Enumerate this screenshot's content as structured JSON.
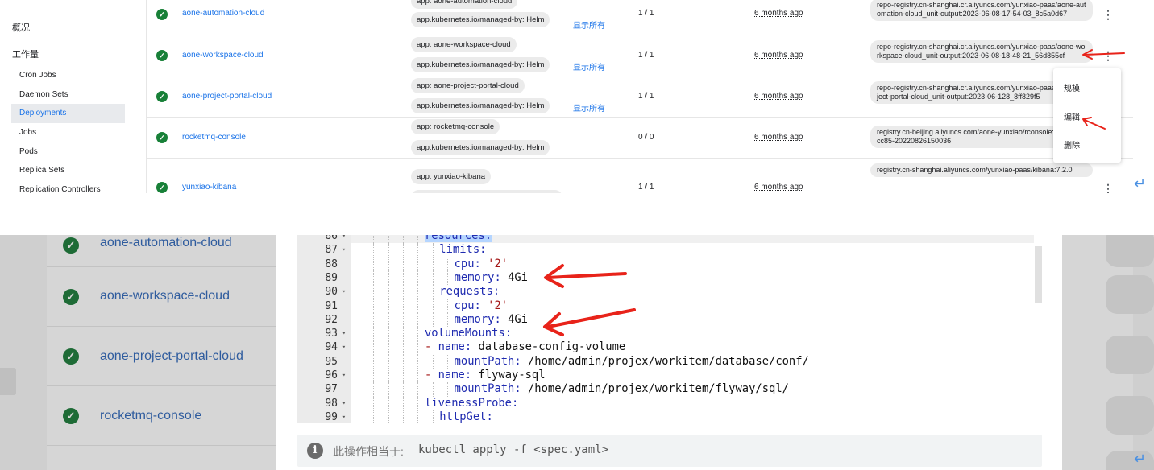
{
  "sidebar": {
    "overview": "概况",
    "workloads": "工作量",
    "items": [
      {
        "label": "Cron Jobs",
        "active": false
      },
      {
        "label": "Daemon Sets",
        "active": false
      },
      {
        "label": "Deployments",
        "active": true
      },
      {
        "label": "Jobs",
        "active": false
      },
      {
        "label": "Pods",
        "active": false
      },
      {
        "label": "Replica Sets",
        "active": false
      },
      {
        "label": "Replication Controllers",
        "active": false
      }
    ]
  },
  "deployments": [
    {
      "name": "aone-automation-cloud",
      "labels": [
        "app: aone-automation-cloud",
        "app.kubernetes.io/managed-by: Helm"
      ],
      "show_all": "显示所有",
      "pods": "1 / 1",
      "created": "6 months ago",
      "image": "repo-registry.cn-shanghai.cr.aliyuncs.com/yunxiao-paas/aone-automation-cloud_unit-output:2023-06-08-17-54-03_8c5a0d67"
    },
    {
      "name": "aone-workspace-cloud",
      "labels": [
        "app: aone-workspace-cloud",
        "app.kubernetes.io/managed-by: Helm"
      ],
      "show_all": "显示所有",
      "pods": "1 / 1",
      "created": "6 months ago",
      "image": "repo-registry.cn-shanghai.cr.aliyuncs.com/yunxiao-paas/aone-workspace-cloud_unit-output:2023-06-08-18-48-21_56d855cf"
    },
    {
      "name": "aone-project-portal-cloud",
      "labels": [
        "app: aone-project-portal-cloud",
        "app.kubernetes.io/managed-by: Helm"
      ],
      "show_all": "显示所有",
      "pods": "1 / 1",
      "created": "6 months ago",
      "image": "repo-registry.cn-shanghai.cr.aliyuncs.com/yunxiao-paas/aone-project-portal-cloud_unit-output:2023-06-128_8ff829f5"
    },
    {
      "name": "rocketmq-console",
      "labels": [
        "app: rocketmq-console",
        "app.kubernetes.io/managed-by: Helm"
      ],
      "show_all": "",
      "pods": "0 / 0",
      "created": "6 months ago",
      "image": "registry.cn-beijing.aliyuncs.com/aone-yunxiao/rconsole:2.0.0-d2acc85-20220826150036"
    },
    {
      "name": "yunxiao-kibana",
      "labels": [
        "app: yunxiao-kibana"
      ],
      "show_all": "",
      "pods": "1 / 1",
      "created": "6 months ago",
      "image": "registry.cn-shanghai.aliyuncs.com/yunxiao-paas/kibana:7.2.0"
    }
  ],
  "context_menu": {
    "scale": "规模",
    "edit": "编辑",
    "delete": "删除"
  },
  "icons": {
    "status": "check-circle-icon",
    "more": "more-vertical-icon",
    "enter": "return-arrow-icon",
    "info": "info-icon"
  },
  "symbols": {
    "check": "✓",
    "kebab": "⋮",
    "enter": "↵",
    "info": "i",
    "fold": "▾"
  },
  "editor": {
    "lines": [
      {
        "num": "86",
        "fold": true,
        "indent": 5,
        "key": "resources",
        "value": "",
        "dash": false
      },
      {
        "num": "87",
        "fold": true,
        "indent": 6,
        "key": "limits",
        "value": "",
        "dash": false
      },
      {
        "num": "88",
        "fold": false,
        "indent": 7,
        "key": "cpu",
        "value": "'2'",
        "dash": false
      },
      {
        "num": "89",
        "fold": false,
        "indent": 7,
        "key": "memory",
        "value": "4Gi",
        "dash": false
      },
      {
        "num": "90",
        "fold": true,
        "indent": 6,
        "key": "requests",
        "value": "",
        "dash": false
      },
      {
        "num": "91",
        "fold": false,
        "indent": 7,
        "key": "cpu",
        "value": "'2'",
        "dash": false
      },
      {
        "num": "92",
        "fold": false,
        "indent": 7,
        "key": "memory",
        "value": "4Gi",
        "dash": false
      },
      {
        "num": "93",
        "fold": true,
        "indent": 5,
        "key": "volumeMounts",
        "value": "",
        "dash": false
      },
      {
        "num": "94",
        "fold": true,
        "indent": 6,
        "key": "name",
        "value": "database-config-volume",
        "dash": true
      },
      {
        "num": "95",
        "fold": false,
        "indent": 7,
        "key": "mountPath",
        "value": "/home/admin/projex/workitem/database/conf/",
        "dash": false
      },
      {
        "num": "96",
        "fold": true,
        "indent": 6,
        "key": "name",
        "value": "flyway-sql",
        "dash": true
      },
      {
        "num": "97",
        "fold": false,
        "indent": 7,
        "key": "mountPath",
        "value": "/home/admin/projex/workitem/flyway/sql/",
        "dash": false
      },
      {
        "num": "98",
        "fold": true,
        "indent": 5,
        "key": "livenessProbe",
        "value": "",
        "dash": false
      },
      {
        "num": "99",
        "fold": true,
        "indent": 6,
        "key": "httpGet",
        "value": "",
        "dash": false
      }
    ]
  },
  "info_bar": {
    "label": "此操作相当于:",
    "command": "kubectl apply -f <spec.yaml>"
  },
  "colors": {
    "link": "#1a73e8",
    "success": "#188038",
    "annotation_arrow": "#e8231a",
    "yaml_key": "#1f2bb0",
    "yaml_string": "#a31515"
  }
}
